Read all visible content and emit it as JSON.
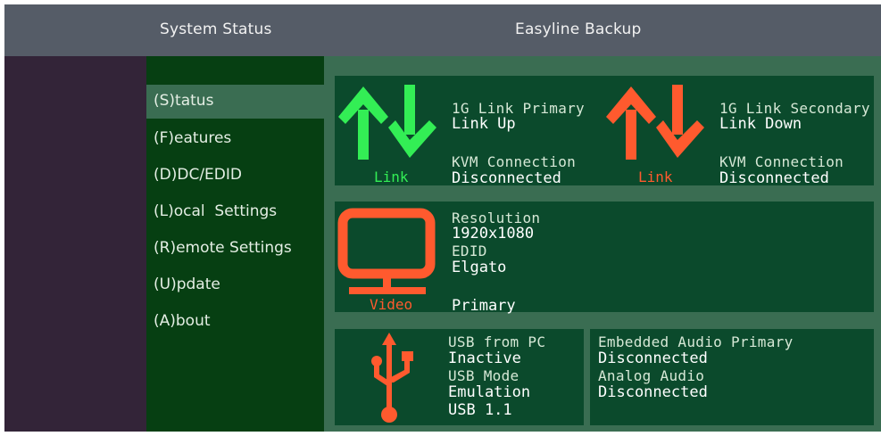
{
  "header": {
    "left_title": "System Status",
    "right_title": "Easyline Backup"
  },
  "nav": {
    "items": [
      {
        "label": "(S)tatus",
        "active": true
      },
      {
        "label": "(F)eatures"
      },
      {
        "label": "(D)DC/EDID"
      },
      {
        "label": "(L)ocal  Settings"
      },
      {
        "label": "(R)emote Settings"
      },
      {
        "label": "(U)pdate"
      },
      {
        "label": "(A)bout"
      }
    ]
  },
  "link_primary": {
    "icon": "link-up-arrows-icon",
    "color": "#33ee55",
    "caption": "Link",
    "title": "1G Link Primary",
    "status": "Link Up",
    "kvm_label": "KVM Connection",
    "kvm_value": "Disconnected"
  },
  "link_secondary": {
    "icon": "link-down-arrows-icon",
    "color": "#ff5a2e",
    "caption": "Link",
    "title": "1G Link Secondary",
    "status": "Link Down",
    "kvm_label": "KVM Connection",
    "kvm_value": "Disconnected"
  },
  "video": {
    "icon": "monitor-icon",
    "color": "#ff5a2e",
    "caption": "Video",
    "resolution_label": "Resolution",
    "resolution_value": "1920x1080",
    "edid_label": "EDID",
    "edid_value": "Elgato",
    "source": "Primary"
  },
  "usb": {
    "icon": "usb-icon",
    "color": "#ff5a2e",
    "from_pc_label": "USB from PC",
    "from_pc_value": "Inactive",
    "mode_label": "USB Mode",
    "mode_value": "Emulation",
    "version": "USB 1.1"
  },
  "audio": {
    "embedded_label": "Embedded Audio Primary",
    "embedded_value": "Disconnected",
    "analog_label": "Analog Audio",
    "analog_value": "Disconnected"
  }
}
